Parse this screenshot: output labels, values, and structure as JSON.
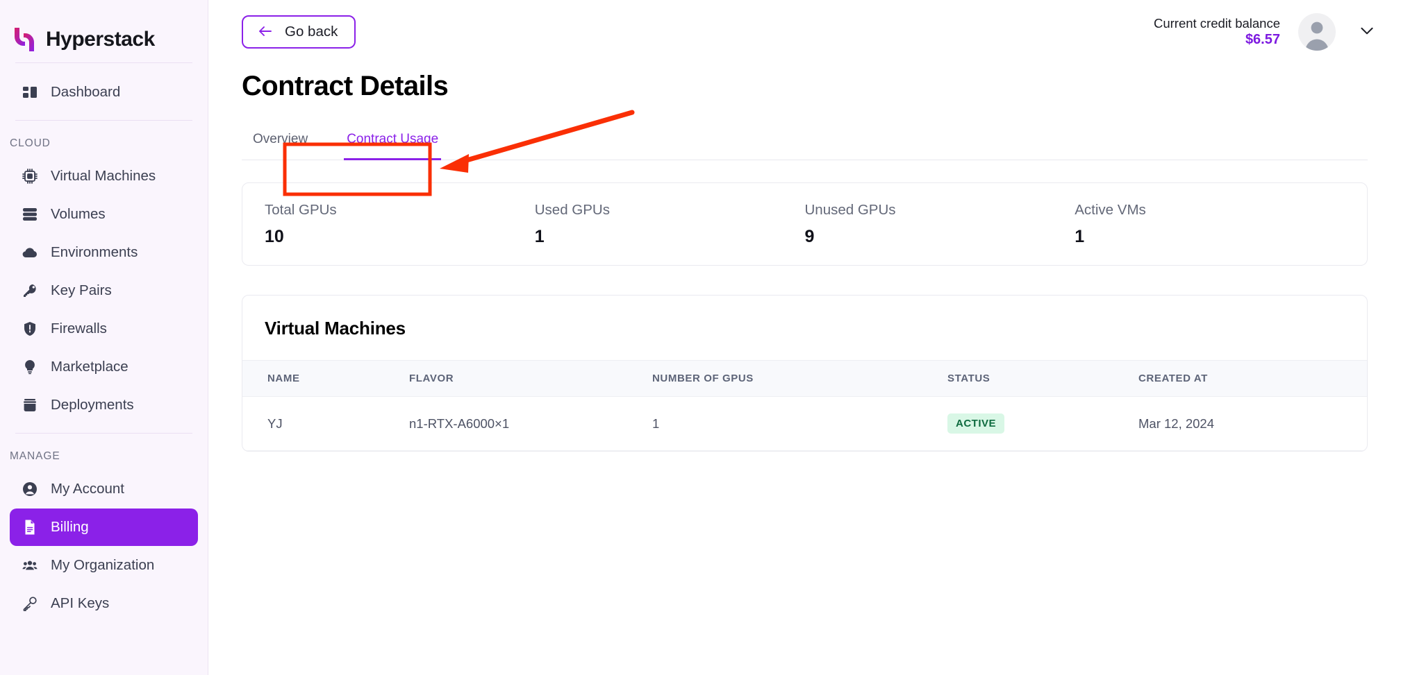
{
  "brand": {
    "name": "Hyperstack",
    "logo_icon": "hyperstack-logo-icon"
  },
  "sidebar": {
    "top_items": [
      {
        "label": "Dashboard",
        "icon": "dashboard-icon",
        "active": false
      }
    ],
    "groups": [
      {
        "label": "CLOUD",
        "items": [
          {
            "label": "Virtual Machines",
            "icon": "cpu-chip-icon",
            "active": false
          },
          {
            "label": "Volumes",
            "icon": "database-stack-icon",
            "active": false
          },
          {
            "label": "Environments",
            "icon": "cloud-icon",
            "active": false
          },
          {
            "label": "Key Pairs",
            "icon": "key-icon",
            "active": false
          },
          {
            "label": "Firewalls",
            "icon": "shield-icon",
            "active": false
          },
          {
            "label": "Marketplace",
            "icon": "lightbulb-icon",
            "active": false
          },
          {
            "label": "Deployments",
            "icon": "box-icon",
            "active": false
          }
        ]
      },
      {
        "label": "MANAGE",
        "items": [
          {
            "label": "My Account",
            "icon": "user-circle-icon",
            "active": false
          },
          {
            "label": "Billing",
            "icon": "document-icon",
            "active": true
          },
          {
            "label": "My Organization",
            "icon": "users-group-icon",
            "active": false
          },
          {
            "label": "API Keys",
            "icon": "key-outline-icon",
            "active": false
          }
        ]
      }
    ]
  },
  "topbar": {
    "go_back_label": "Go back",
    "back_arrow_icon": "arrow-left-icon",
    "credit_label": "Current credit balance",
    "credit_amount": "$6.57",
    "avatar_icon": "user-avatar-icon",
    "chevron_icon": "chevron-down-icon"
  },
  "page": {
    "title": "Contract Details",
    "tabs": [
      {
        "label": "Overview",
        "active": false
      },
      {
        "label": "Contract Usage",
        "active": true
      }
    ]
  },
  "stats": [
    {
      "label": "Total GPUs",
      "value": "10"
    },
    {
      "label": "Used GPUs",
      "value": "1"
    },
    {
      "label": "Unused GPUs",
      "value": "9"
    },
    {
      "label": "Active VMs",
      "value": "1"
    }
  ],
  "vm_section": {
    "title": "Virtual Machines",
    "columns": [
      "NAME",
      "FLAVOR",
      "NUMBER OF GPUS",
      "STATUS",
      "CREATED AT"
    ],
    "rows": [
      {
        "name": "YJ",
        "flavor": "n1-RTX-A6000×1",
        "number_of_gpus": "1",
        "status": "ACTIVE",
        "created_at": "Mar 12, 2024"
      }
    ]
  },
  "annotation": {
    "highlight_color": "#fa2f05",
    "target": "Contract Usage",
    "shapes": [
      "rectangle-highlight",
      "arrow-pointer"
    ]
  },
  "colors": {
    "accent": "#8b21e8",
    "sidebar_bg": "#faf5fd",
    "credit_amount": "#7d1ae0",
    "badge_bg": "#d9f7e6",
    "badge_text": "#0e6b3f",
    "annotation": "#fa2f05"
  }
}
